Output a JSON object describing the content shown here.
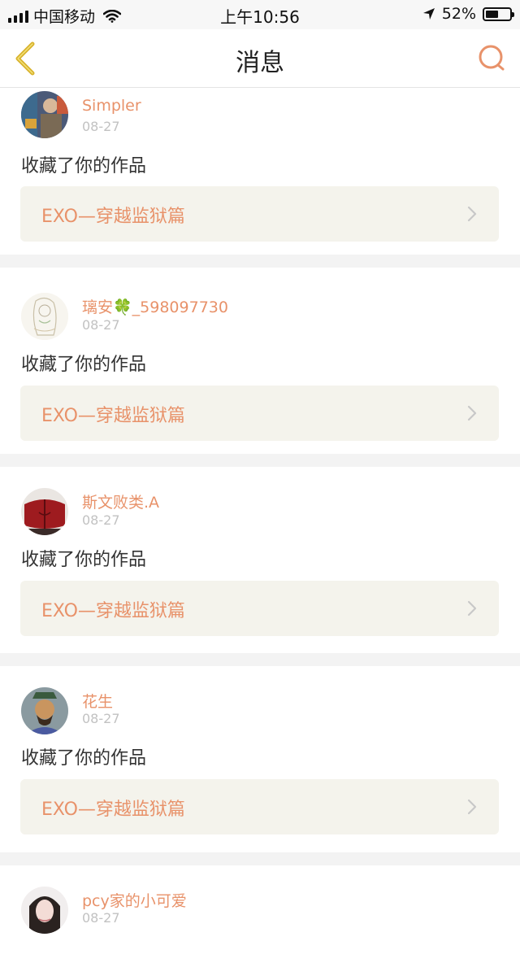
{
  "status_bar": {
    "carrier": "中国移动",
    "time": "上午10:56",
    "battery_percent": "52%",
    "battery_level": 0.52
  },
  "nav": {
    "title": "消息",
    "back_icon": "chevron-left-icon",
    "search_icon": "search-icon"
  },
  "colors": {
    "accent": "#e8926a",
    "back_icon": "#d8b22c",
    "link_bg": "#f4f3ec"
  },
  "notifications": [
    {
      "username": "Simpler",
      "date": "08-27",
      "action": "收藏了你的作品",
      "work_title": "EXO—穿越监狱篇"
    },
    {
      "username": "璃安🍀_598097730",
      "date": "08-27",
      "action": "收藏了你的作品",
      "work_title": "EXO—穿越监狱篇"
    },
    {
      "username": "斯文败类.A",
      "date": "08-27",
      "action": "收藏了你的作品",
      "work_title": "EXO—穿越监狱篇"
    },
    {
      "username": "花生",
      "date": "08-27",
      "action": "收藏了你的作品",
      "work_title": "EXO—穿越监狱篇"
    },
    {
      "username": "pcy家的小可爱",
      "date": "08-27",
      "action": "",
      "work_title": ""
    }
  ]
}
